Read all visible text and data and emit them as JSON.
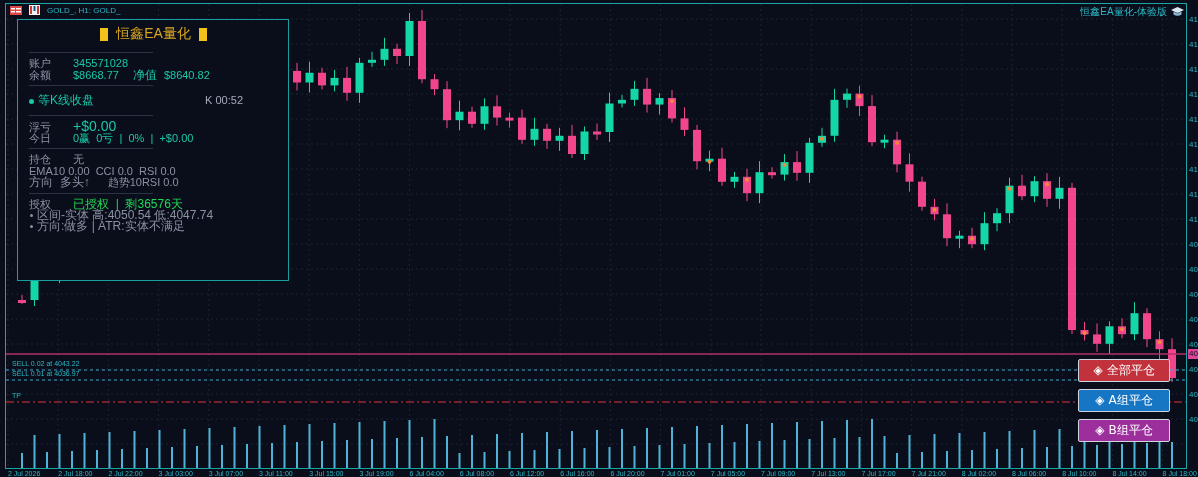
{
  "chart_header": {
    "title": "GOLD_, H1: GOLD_"
  },
  "brand": {
    "title": "恒鑫EA量化-体验版"
  },
  "panel": {
    "title": "恒鑫EA量化",
    "account": {
      "label": "账户",
      "value": "345571028"
    },
    "balance": {
      "label": "余额",
      "value": "$8668.77",
      "equity_label": "净值",
      "equity": "$8640.82"
    },
    "status": {
      "text": "等K线收盘",
      "timer": "K 00:52"
    },
    "floating": {
      "label": "浮亏",
      "value": "+$0.00"
    },
    "today": {
      "label": "今日",
      "value": "0赢  0亏  |  0%  |  +$0.00"
    },
    "position": {
      "label": "持仓",
      "value": "无"
    },
    "indicators": "EMA10 0.00  CCI 0.0  RSI 0.0",
    "direction": {
      "text": "方向  多头↑",
      "trend": "趋势10RSI 0.0"
    },
    "license": {
      "label": "授权",
      "value": "已授权  |  剩36576天"
    },
    "notes": [
      "区间-实体 高:4050.54 低:4047.74",
      "方向:做多 | ATR:实体不满足"
    ]
  },
  "order_lines": [
    {
      "kind": "sell",
      "label": "SELL 0.02 at 4043.22"
    },
    {
      "kind": "sell",
      "label": "SELL 0.01 at 4036.97"
    },
    {
      "kind": "tp",
      "label": "TP"
    }
  ],
  "current_price_label": "40",
  "buttons": [
    {
      "label": "◈ 全部平仓",
      "color": "#c1323c"
    },
    {
      "label": "◈ A组平仓",
      "color": "#1676c4"
    },
    {
      "label": "◈ B组平仓",
      "color": "#9c2f9c"
    }
  ],
  "price_axis": [
    "41",
    "41",
    "41",
    "41",
    "41",
    "41",
    "41",
    "41",
    "41",
    "40",
    "40",
    "40",
    "40",
    "40",
    "40",
    "40",
    "40"
  ],
  "time_axis": [
    "2 Jul 2026",
    "2 Jul 18:00",
    "2 Jul 22:00",
    "3 Jul 03:00",
    "3 Jul 07:00",
    "3 Jul 11:00",
    "3 Jul 15:00",
    "3 Jul 19:00",
    "6 Jul 04:00",
    "6 Jul 08:00",
    "6 Jul 12:00",
    "6 Jul 16:00",
    "6 Jul 20:00",
    "7 Jul 01:00",
    "7 Jul 05:00",
    "7 Jul 09:00",
    "7 Jul 13:00",
    "7 Jul 17:00",
    "7 Jul 21:00",
    "8 Jul 02:00",
    "8 Jul 06:00",
    "8 Jul 10:00",
    "8 Jul 14:00",
    "8 Jul 18:00"
  ]
}
